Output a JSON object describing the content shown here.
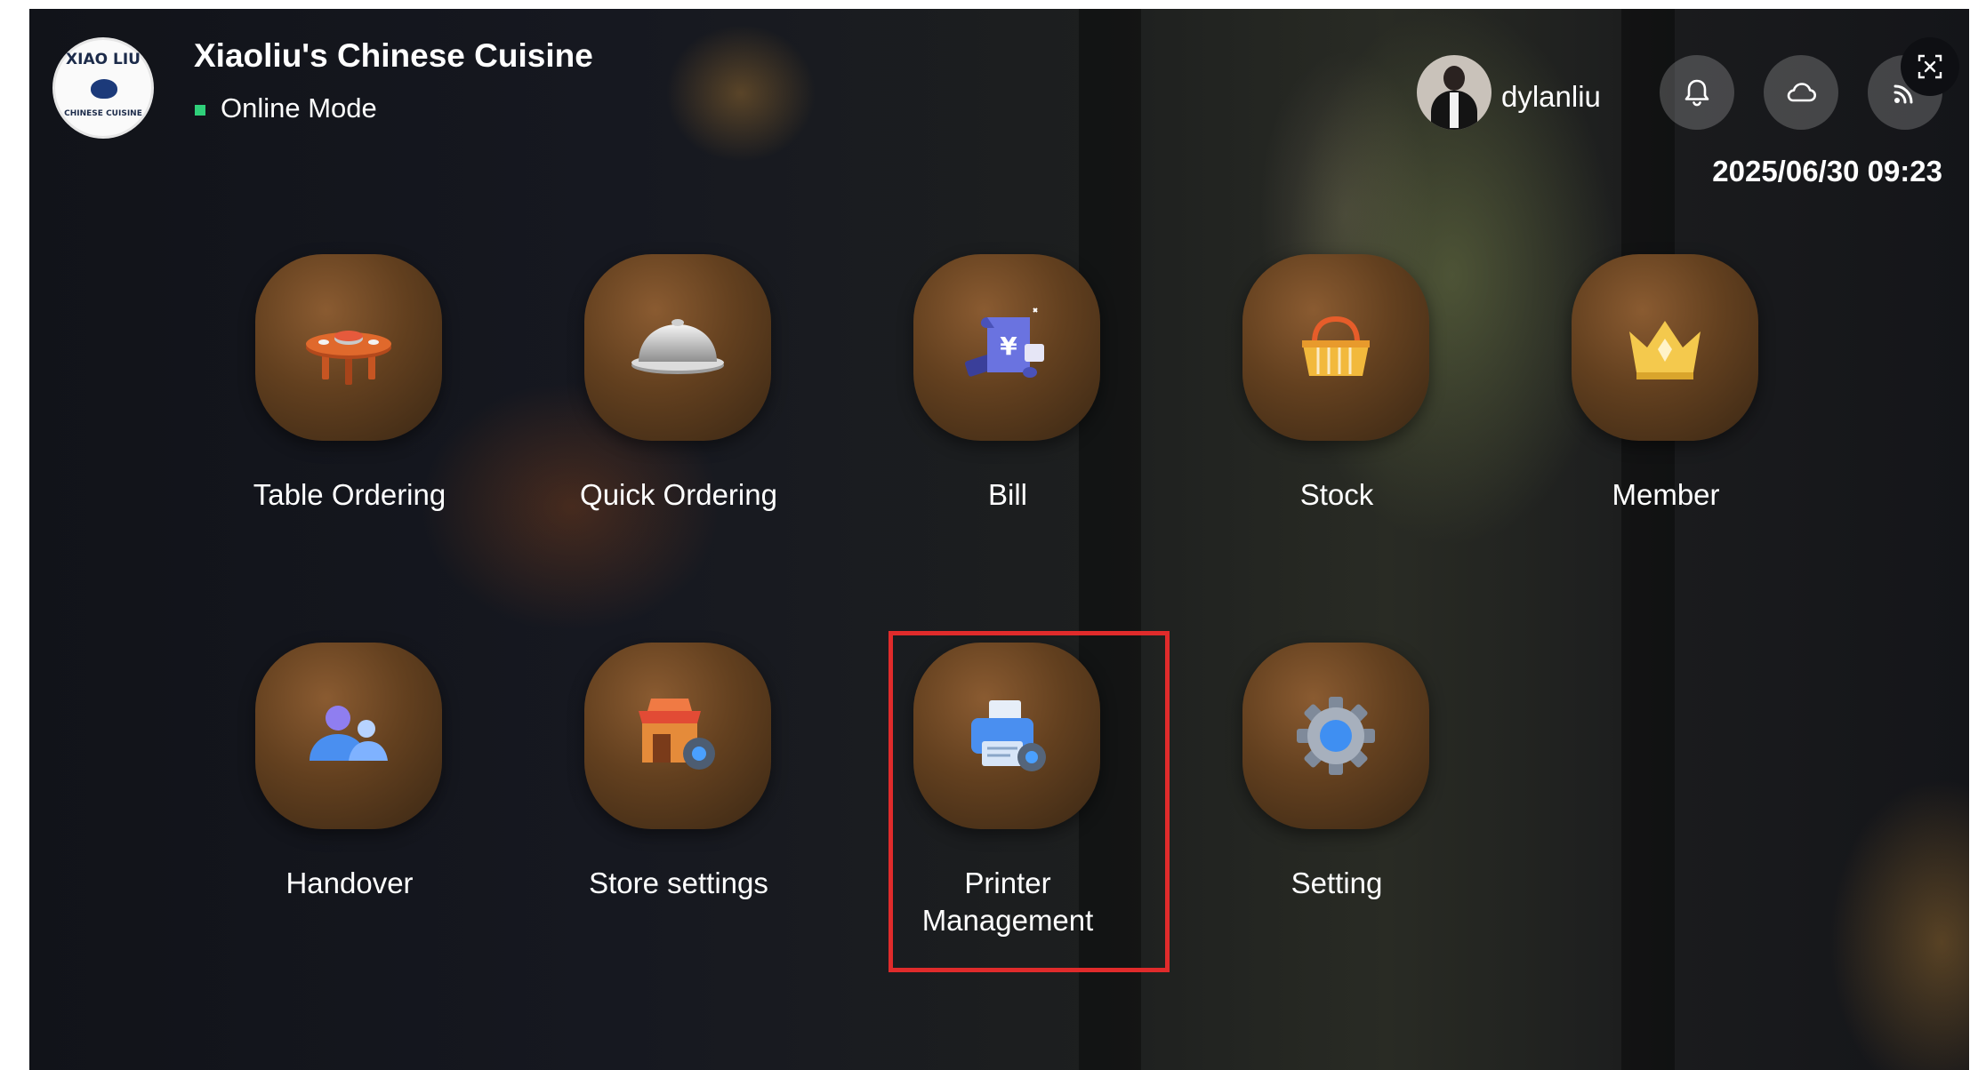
{
  "header": {
    "store_name": "Xiaoliu's Chinese Cuisine",
    "mode": "Online Mode",
    "logo": {
      "text_top": "XIAO LIU",
      "text_bottom": "CHINESE CUISINE"
    },
    "user": {
      "name": "dylanliu"
    },
    "datetime": "2025/06/30 09:23",
    "icons": [
      "bell-icon",
      "cloud-icon",
      "signal-icon",
      "scan-icon"
    ]
  },
  "menu": {
    "items": [
      {
        "label": "Table Ordering",
        "icon": "table-icon"
      },
      {
        "label": "Quick Ordering",
        "icon": "cloche-icon"
      },
      {
        "label": "Bill",
        "icon": "bill-icon"
      },
      {
        "label": "Stock",
        "icon": "basket-icon"
      },
      {
        "label": "Member",
        "icon": "crown-icon"
      },
      {
        "label": "Handover",
        "icon": "users-icon"
      },
      {
        "label": "Store settings",
        "icon": "store-gear-icon"
      },
      {
        "label": "Printer\nManagement",
        "icon": "printer-icon"
      },
      {
        "label": "Setting",
        "icon": "gear-icon"
      }
    ]
  },
  "colors": {
    "online_indicator": "#2fd07a",
    "highlight": "#e02b2b",
    "tile_brown": "#63401f"
  }
}
